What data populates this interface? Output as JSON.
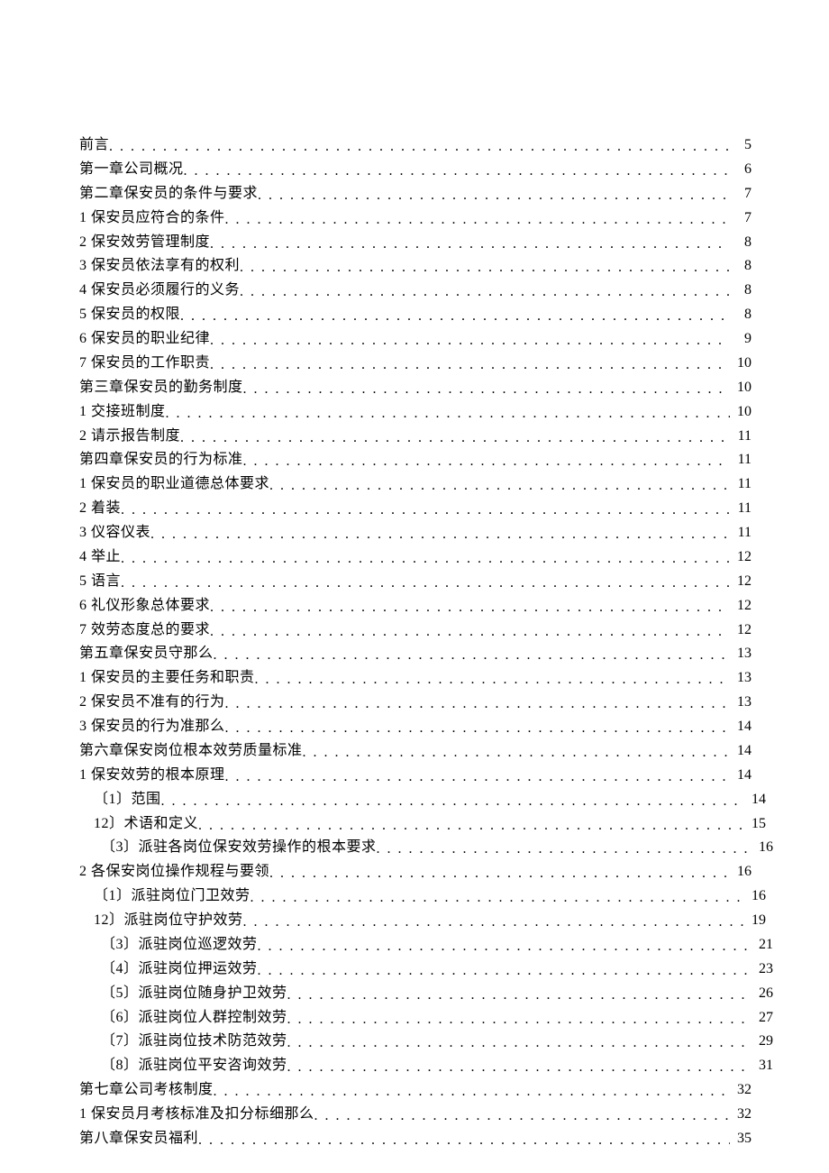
{
  "toc": [
    {
      "title": "前言",
      "page": "5",
      "indent": 0
    },
    {
      "title": "第一章公司概况",
      "page": "6",
      "indent": 0
    },
    {
      "title": "第二章保安员的条件与要求",
      "page": "7",
      "indent": 0
    },
    {
      "title": "1 保安员应符合的条件",
      "page": "7",
      "indent": 0
    },
    {
      "title": "2 保安效劳管理制度",
      "page": "8",
      "indent": 0
    },
    {
      "title": "3 保安员依法享有的权利",
      "page": "8",
      "indent": 0
    },
    {
      "title": "4 保安员必须履行的义务",
      "page": "8",
      "indent": 0
    },
    {
      "title": "5 保安员的权限",
      "page": "8",
      "indent": 0
    },
    {
      "title": "6 保安员的职业纪律",
      "page": "9",
      "indent": 0
    },
    {
      "title": "7 保安员的工作职责",
      "page": "10",
      "indent": 0
    },
    {
      "title": "第三章保安员的勤务制度",
      "page": "10",
      "indent": 0
    },
    {
      "title": "1 交接班制度",
      "page": "10",
      "indent": 0
    },
    {
      "title": "2 请示报告制度",
      "page": "11",
      "indent": 0
    },
    {
      "title": "第四章保安员的行为标准",
      "page": "11",
      "indent": 0
    },
    {
      "title": "1 保安员的职业道德总体要求",
      "page": "11",
      "indent": 0
    },
    {
      "title": "2 着装",
      "page": "11",
      "indent": 0
    },
    {
      "title": "3 仪容仪表",
      "page": "11",
      "indent": 0
    },
    {
      "title": "4 举止",
      "page": "12",
      "indent": 0
    },
    {
      "title": "5 语言",
      "page": "12",
      "indent": 0
    },
    {
      "title": "6 礼仪形象总体要求",
      "page": "12",
      "indent": 0
    },
    {
      "title": "7 效劳态度总的要求",
      "page": "12",
      "indent": 0
    },
    {
      "title": "第五章保安员守那么",
      "page": "13",
      "indent": 0
    },
    {
      "title": "1 保安员的主要任务和职责",
      "page": "13",
      "indent": 0
    },
    {
      "title": "2 保安员不准有的行为",
      "page": "13",
      "indent": 0
    },
    {
      "title": "3 保安员的行为准那么",
      "page": "14",
      "indent": 0
    },
    {
      "title": "第六章保安岗位根本效劳质量标准",
      "page": "14",
      "indent": 0
    },
    {
      "title": "1 保安效劳的根本原理",
      "page": "14",
      "indent": 0
    },
    {
      "title": "〔1〕范围",
      "page": "14",
      "indent": 1
    },
    {
      "title": "12〕术语和定义",
      "page": "15",
      "indent": 1
    },
    {
      "title": "〔3〕派驻各岗位保安效劳操作的根本要求",
      "page": "16",
      "indent": 2
    },
    {
      "title": "2 各保安岗位操作规程与要领",
      "page": "16",
      "indent": 0
    },
    {
      "title": "〔1〕派驻岗位门卫效劳",
      "page": "16",
      "indent": 1
    },
    {
      "title": "12〕派驻岗位守护效劳",
      "page": "19",
      "indent": 1
    },
    {
      "title": "〔3〕派驻岗位巡逻效劳",
      "page": "21",
      "indent": 2
    },
    {
      "title": "〔4〕派驻岗位押运效劳",
      "page": "23",
      "indent": 2
    },
    {
      "title": "〔5〕派驻岗位随身护卫效劳",
      "page": "26",
      "indent": 2
    },
    {
      "title": "〔6〕派驻岗位人群控制效劳",
      "page": "27",
      "indent": 2
    },
    {
      "title": "〔7〕派驻岗位技术防范效劳",
      "page": "29",
      "indent": 2
    },
    {
      "title": "〔8〕派驻岗位平安咨询效劳",
      "page": "31",
      "indent": 2
    },
    {
      "title": "第七章公司考核制度",
      "page": "32",
      "indent": 0
    },
    {
      "title": "1 保安员月考核标准及扣分标细那么",
      "page": "32",
      "indent": 0
    },
    {
      "title": "第八章保安员福利",
      "page": "35",
      "indent": 0
    }
  ]
}
